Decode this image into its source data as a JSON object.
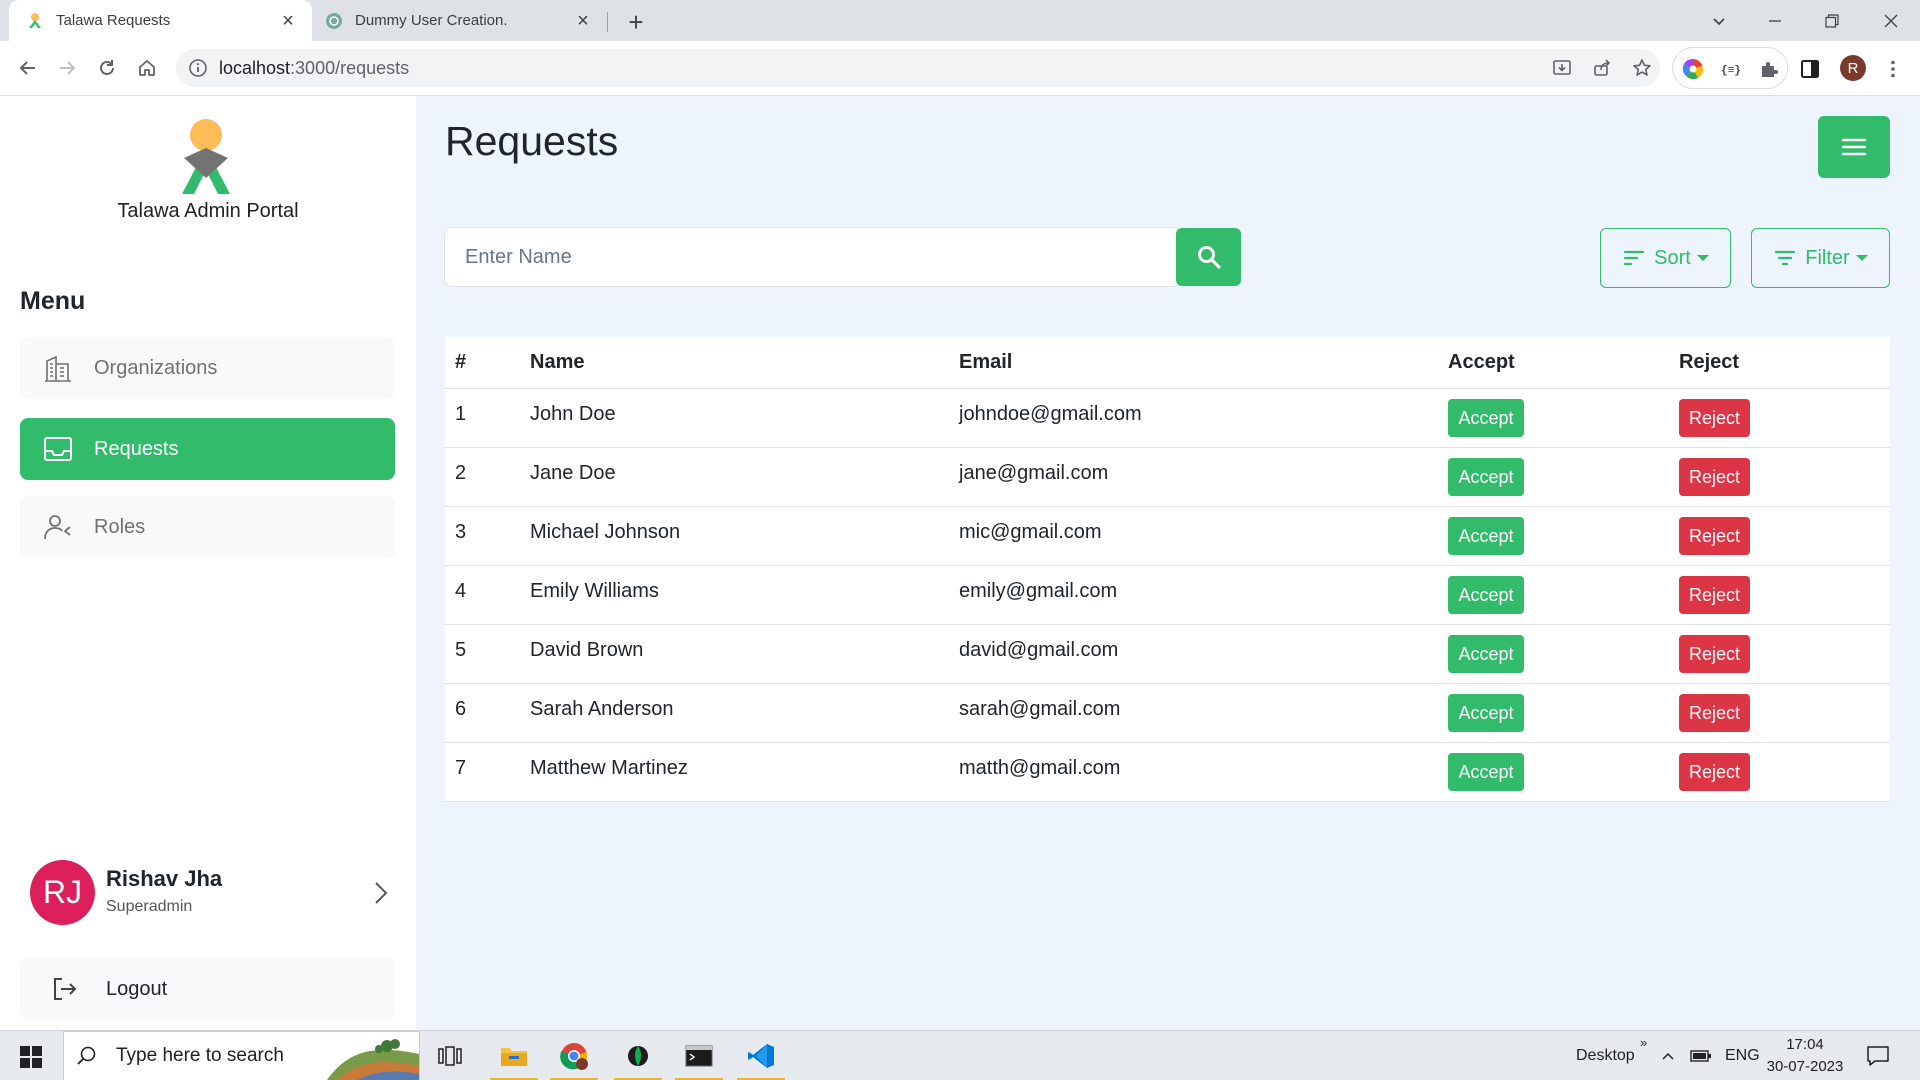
{
  "browser": {
    "tabs": [
      {
        "title": "Talawa Requests",
        "active": true
      },
      {
        "title": "Dummy User Creation.",
        "active": false
      }
    ],
    "address": {
      "host": "localhost",
      "path": ":3000/requests"
    }
  },
  "sidebar": {
    "brand": "Talawa Admin Portal",
    "menu_title": "Menu",
    "items": [
      {
        "label": "Organizations",
        "icon": "organizations-icon",
        "active": false
      },
      {
        "label": "Requests",
        "icon": "requests-icon",
        "active": true
      },
      {
        "label": "Roles",
        "icon": "roles-icon",
        "active": false
      }
    ],
    "user": {
      "initials": "RJ",
      "name": "Rishav Jha",
      "role": "Superadmin"
    },
    "logout_label": "Logout"
  },
  "main": {
    "title": "Requests",
    "search": {
      "placeholder": "Enter Name",
      "value": ""
    },
    "sort_label": "Sort",
    "filter_label": "Filter",
    "table": {
      "headers": [
        "#",
        "Name",
        "Email",
        "Accept",
        "Reject"
      ],
      "accept_label": "Accept",
      "reject_label": "Reject",
      "rows": [
        {
          "num": "1",
          "name": "John Doe",
          "email": "johndoe@gmail.com"
        },
        {
          "num": "2",
          "name": "Jane Doe",
          "email": "jane@gmail.com"
        },
        {
          "num": "3",
          "name": "Michael Johnson",
          "email": "mic@gmail.com"
        },
        {
          "num": "4",
          "name": "Emily Williams",
          "email": "emily@gmail.com"
        },
        {
          "num": "5",
          "name": "David Brown",
          "email": "david@gmail.com"
        },
        {
          "num": "6",
          "name": "Sarah Anderson",
          "email": "sarah@gmail.com"
        },
        {
          "num": "7",
          "name": "Matthew Martinez",
          "email": "matth@gmail.com"
        }
      ]
    }
  },
  "taskbar": {
    "search_placeholder": "Type here to search",
    "desktop_label": "Desktop",
    "lang": "ENG",
    "time": "17:04",
    "date": "30-07-2023"
  },
  "colors": {
    "accent": "#31bb6b",
    "danger": "#dc3545",
    "avatar": "#dc1e5b",
    "main_bg": "#eef4fd"
  }
}
